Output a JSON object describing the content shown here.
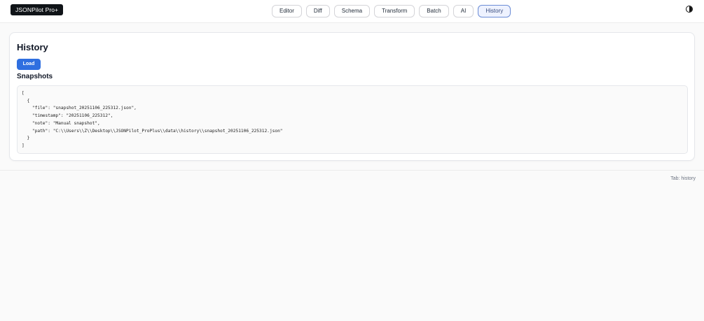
{
  "header": {
    "brand": "JSONPilot Pro+",
    "tabs": [
      {
        "label": "Editor"
      },
      {
        "label": "Diff"
      },
      {
        "label": "Schema"
      },
      {
        "label": "Transform"
      },
      {
        "label": "Batch"
      },
      {
        "label": "AI"
      },
      {
        "label": "History"
      }
    ],
    "active_tab": "History",
    "theme_icon": "contrast-icon"
  },
  "history": {
    "title": "History",
    "load_label": "Load",
    "snapshots_title": "Snapshots",
    "snapshots_json": "[\n  {\n    \"file\": \"snapshot_20251106_225312.json\",\n    \"timestamp\": \"20251106_225312\",\n    \"note\": \"Manual snapshot\",\n    \"path\": \"C:\\\\Users\\\\Z\\\\Desktop\\\\JSONPilot_ProPlus\\\\data\\\\history\\\\snapshot_20251106_225312.json\"\n  }\n]"
  },
  "footer": {
    "status": "Tab: history"
  },
  "colors": {
    "accent": "#2f6fe0",
    "brand_bg": "#101418",
    "active_tab_bg": "#eef2ff",
    "active_tab_border": "#6b8cd6"
  }
}
